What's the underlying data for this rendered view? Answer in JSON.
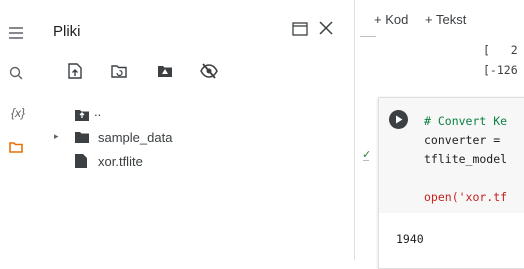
{
  "sidebar": {
    "title": "Pliki",
    "rail_icons": [
      "menu-icon",
      "search-icon",
      "variables-icon",
      "folder-icon"
    ],
    "rail_variables_label": "{x}"
  },
  "toolbar": [
    "upload-icon",
    "folder-refresh-icon",
    "drive-icon",
    "visibility-off-icon"
  ],
  "tree": {
    "parent": "..",
    "items": [
      {
        "label": "sample_data",
        "type": "folder"
      },
      {
        "label": "xor.tflite",
        "type": "file"
      }
    ]
  },
  "notebook": {
    "add_code": "+ Kod",
    "add_text": "+ Tekst",
    "prev_output": {
      "line1": "[   2",
      "line2": "[-126"
    },
    "cell": {
      "code_lines": [
        "# Convert Ke",
        "converter = ",
        "tflite_model",
        "",
        "open('xor.tf"
      ],
      "output": "1940"
    }
  },
  "colors": {
    "accent_orange": "#e8710a",
    "check_green": "#2e7d32",
    "comment_green": "#0b8043",
    "string_red": "#c5221f"
  }
}
